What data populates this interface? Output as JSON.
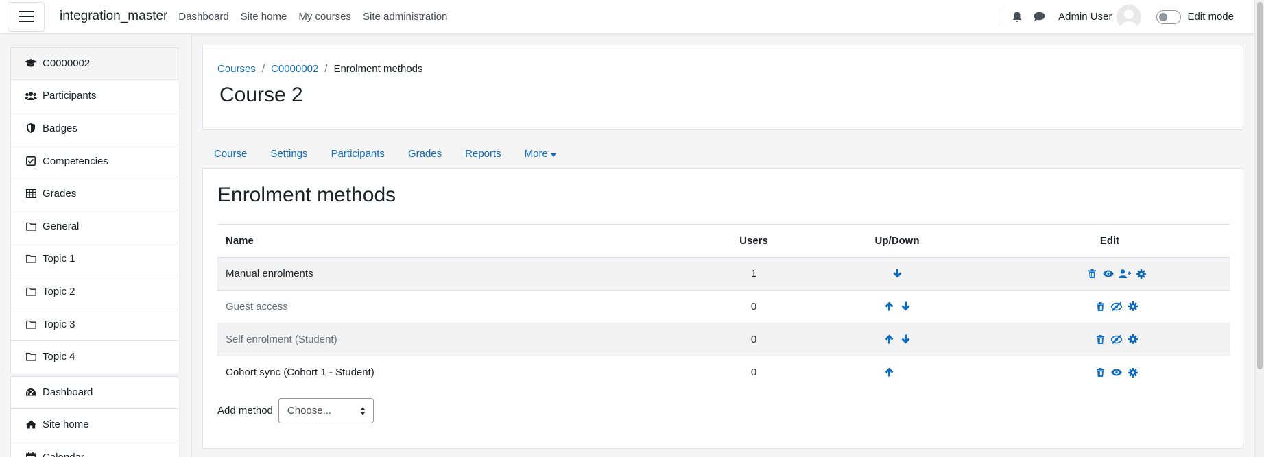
{
  "navbar": {
    "brand": "integration_master",
    "links": [
      "Dashboard",
      "Site home",
      "My courses",
      "Site administration"
    ],
    "user_name": "Admin User",
    "edit_mode_label": "Edit mode"
  },
  "drawer": {
    "course_items": [
      {
        "label": "C0000002",
        "icon": "graduation-cap-icon"
      },
      {
        "label": "Participants",
        "icon": "users-icon"
      },
      {
        "label": "Badges",
        "icon": "shield-icon"
      },
      {
        "label": "Competencies",
        "icon": "check-square-icon"
      },
      {
        "label": "Grades",
        "icon": "table-icon"
      },
      {
        "label": "General",
        "icon": "folder-icon"
      },
      {
        "label": "Topic 1",
        "icon": "folder-icon"
      },
      {
        "label": "Topic 2",
        "icon": "folder-icon"
      },
      {
        "label": "Topic 3",
        "icon": "folder-icon"
      },
      {
        "label": "Topic 4",
        "icon": "folder-icon"
      }
    ],
    "site_items": [
      {
        "label": "Dashboard",
        "icon": "tachometer-icon"
      },
      {
        "label": "Site home",
        "icon": "home-icon"
      },
      {
        "label": "Calendar",
        "icon": "calendar-icon"
      }
    ]
  },
  "header": {
    "breadcrumb": [
      "Courses",
      "C0000002",
      "Enrolment methods"
    ],
    "title": "Course 2"
  },
  "secondary_nav": [
    "Course",
    "Settings",
    "Participants",
    "Grades",
    "Reports",
    "More"
  ],
  "main": {
    "title": "Enrolment methods",
    "table": {
      "headers": [
        "Name",
        "Users",
        "Up/Down",
        "Edit"
      ],
      "rows": [
        {
          "name": "Manual enrolments",
          "users": "1",
          "updown": [
            "down"
          ],
          "edit": [
            "delete",
            "visible",
            "enrol-users",
            "settings"
          ],
          "dimmed": false
        },
        {
          "name": "Guest access",
          "users": "0",
          "updown": [
            "up",
            "down"
          ],
          "edit": [
            "delete",
            "hidden",
            "settings"
          ],
          "dimmed": true
        },
        {
          "name": "Self enrolment (Student)",
          "users": "0",
          "updown": [
            "up",
            "down"
          ],
          "edit": [
            "delete",
            "hidden",
            "settings"
          ],
          "dimmed": true
        },
        {
          "name": "Cohort sync (Cohort 1 - Student)",
          "users": "0",
          "updown": [
            "up"
          ],
          "edit": [
            "delete",
            "visible",
            "settings"
          ],
          "dimmed": false
        }
      ]
    },
    "add_method_label": "Add method",
    "add_method_value": "Choose..."
  },
  "colors": {
    "link": "#0f6cbf",
    "text": "#1d2125",
    "muted": "#6a737b",
    "border": "#dee2e6"
  }
}
